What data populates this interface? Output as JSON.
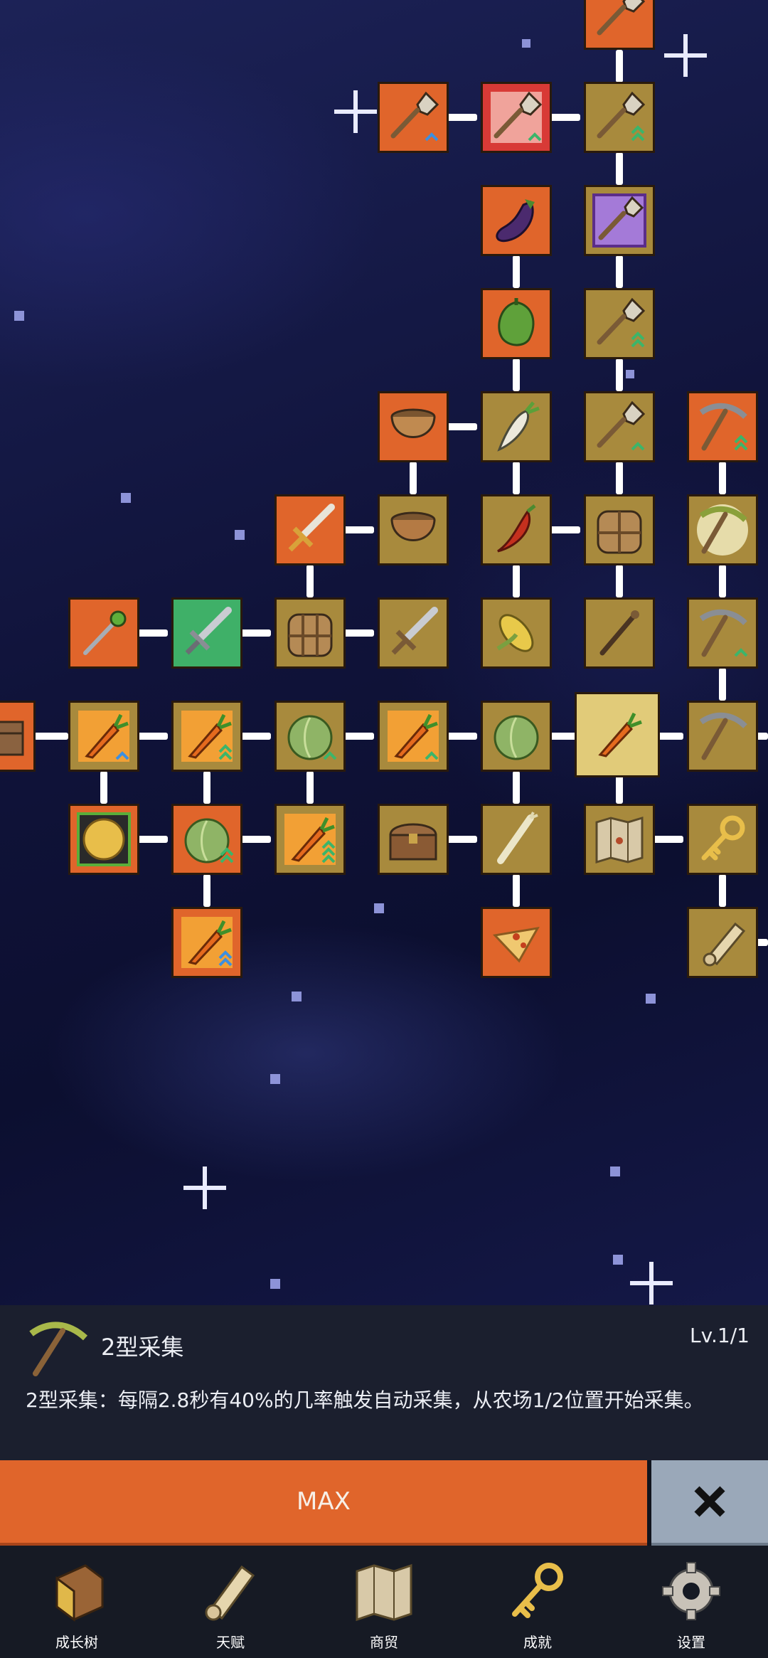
{
  "skill_panel": {
    "name": "2型采集",
    "level": "Lv.1/1",
    "description": "2型采集：每隔2.8秒有40%的几率触发自动采集，从农场1/2位置开始采集。"
  },
  "actions": {
    "max_label": "MAX",
    "close_icon": "close-x-icon"
  },
  "nav": {
    "tree": "成长树",
    "talent": "天赋",
    "trade": "商贸",
    "achievement": "成就",
    "settings": "设置"
  },
  "colors": {
    "orange_node": "#e0652b",
    "gold_node": "#a88a3d",
    "green_node": "#3fb068",
    "selected_node": "#e1cb79",
    "panel_bg": "#1b1f2e",
    "close_btn": "#9aa8b9"
  },
  "tree_nodes": [
    {
      "icon": "shovel-icon",
      "style": "orange"
    },
    {
      "icon": "shovel-icon",
      "style": "red-frame"
    },
    {
      "icon": "shovel-icon",
      "style": "gold"
    },
    {
      "icon": "eggplant-icon",
      "style": "orange"
    },
    {
      "icon": "shovel-purple-icon",
      "style": "gold"
    },
    {
      "icon": "pepper-icon",
      "style": "orange"
    },
    {
      "icon": "bowl-icon",
      "style": "orange"
    },
    {
      "icon": "radish-icon",
      "style": "gold"
    },
    {
      "icon": "pickaxe-icon",
      "style": "orange"
    },
    {
      "icon": "sword-icon",
      "style": "orange"
    },
    {
      "icon": "chili-icon",
      "style": "gold"
    },
    {
      "icon": "backpack-icon",
      "style": "gold"
    },
    {
      "icon": "pickaxe-icon",
      "style": "gold"
    },
    {
      "icon": "staff-icon",
      "style": "orange"
    },
    {
      "icon": "sword-icon",
      "style": "green"
    },
    {
      "icon": "corn-icon",
      "style": "gold"
    },
    {
      "icon": "carrot-icon",
      "style": "selected"
    },
    {
      "icon": "cabbage-icon",
      "style": "gold"
    },
    {
      "icon": "coin-icon",
      "style": "orange"
    },
    {
      "icon": "chest-icon",
      "style": "gold"
    },
    {
      "icon": "map-icon",
      "style": "gold"
    },
    {
      "icon": "key-icon",
      "style": "gold"
    },
    {
      "icon": "pizza-icon",
      "style": "orange"
    },
    {
      "icon": "scroll-icon",
      "style": "gold"
    }
  ]
}
